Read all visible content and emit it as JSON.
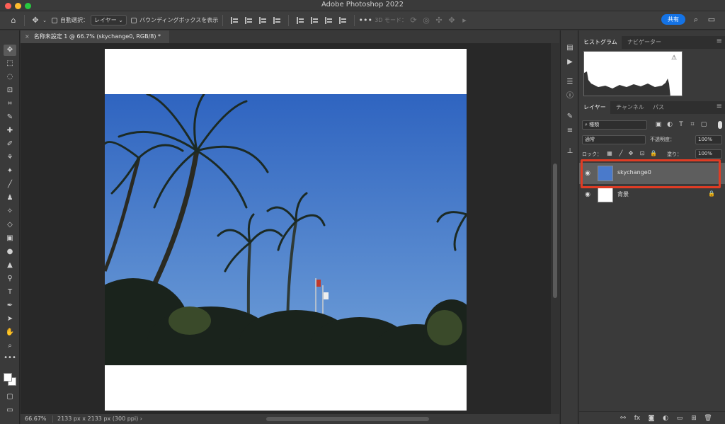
{
  "app": {
    "title": "Adobe Photoshop 2022"
  },
  "options_bar": {
    "auto_select_label": "自動選択：",
    "auto_select_value": "レイヤー",
    "bbox_label": "バウンディングボックスを表示",
    "mode_3d_label": "3D モード：",
    "share_label": "共有"
  },
  "document": {
    "tab_title": "名称未設定 1 @ 66.7% (skychange0, RGB/8) *",
    "close_glyph": "×"
  },
  "status": {
    "zoom": "66.67%",
    "doc_info": "2133 px x 2133 px (300 ppi)",
    "arrow": "›"
  },
  "top_panel": {
    "tabs": [
      "ヒストグラム",
      "ナビゲーター"
    ],
    "active_tab": 0
  },
  "layers_panel": {
    "tabs": [
      "レイヤー",
      "チャンネル",
      "パス"
    ],
    "active_tab": 0,
    "filter_value": "種類",
    "blend_mode": "通常",
    "opacity_label": "不透明度：",
    "opacity_value": "100%",
    "lock_label": "ロック：",
    "fill_label": "塗り：",
    "fill_value": "100%",
    "layers": [
      {
        "name": "skychange0",
        "selected": true,
        "visible": true,
        "locked": false
      },
      {
        "name": "背景",
        "selected": false,
        "visible": true,
        "locked": true
      }
    ]
  },
  "colors": {
    "share_button": "#1473e6",
    "highlight": "#e03c24",
    "sky_top": "#2f64c0",
    "sky_bottom": "#6f9fd8"
  }
}
